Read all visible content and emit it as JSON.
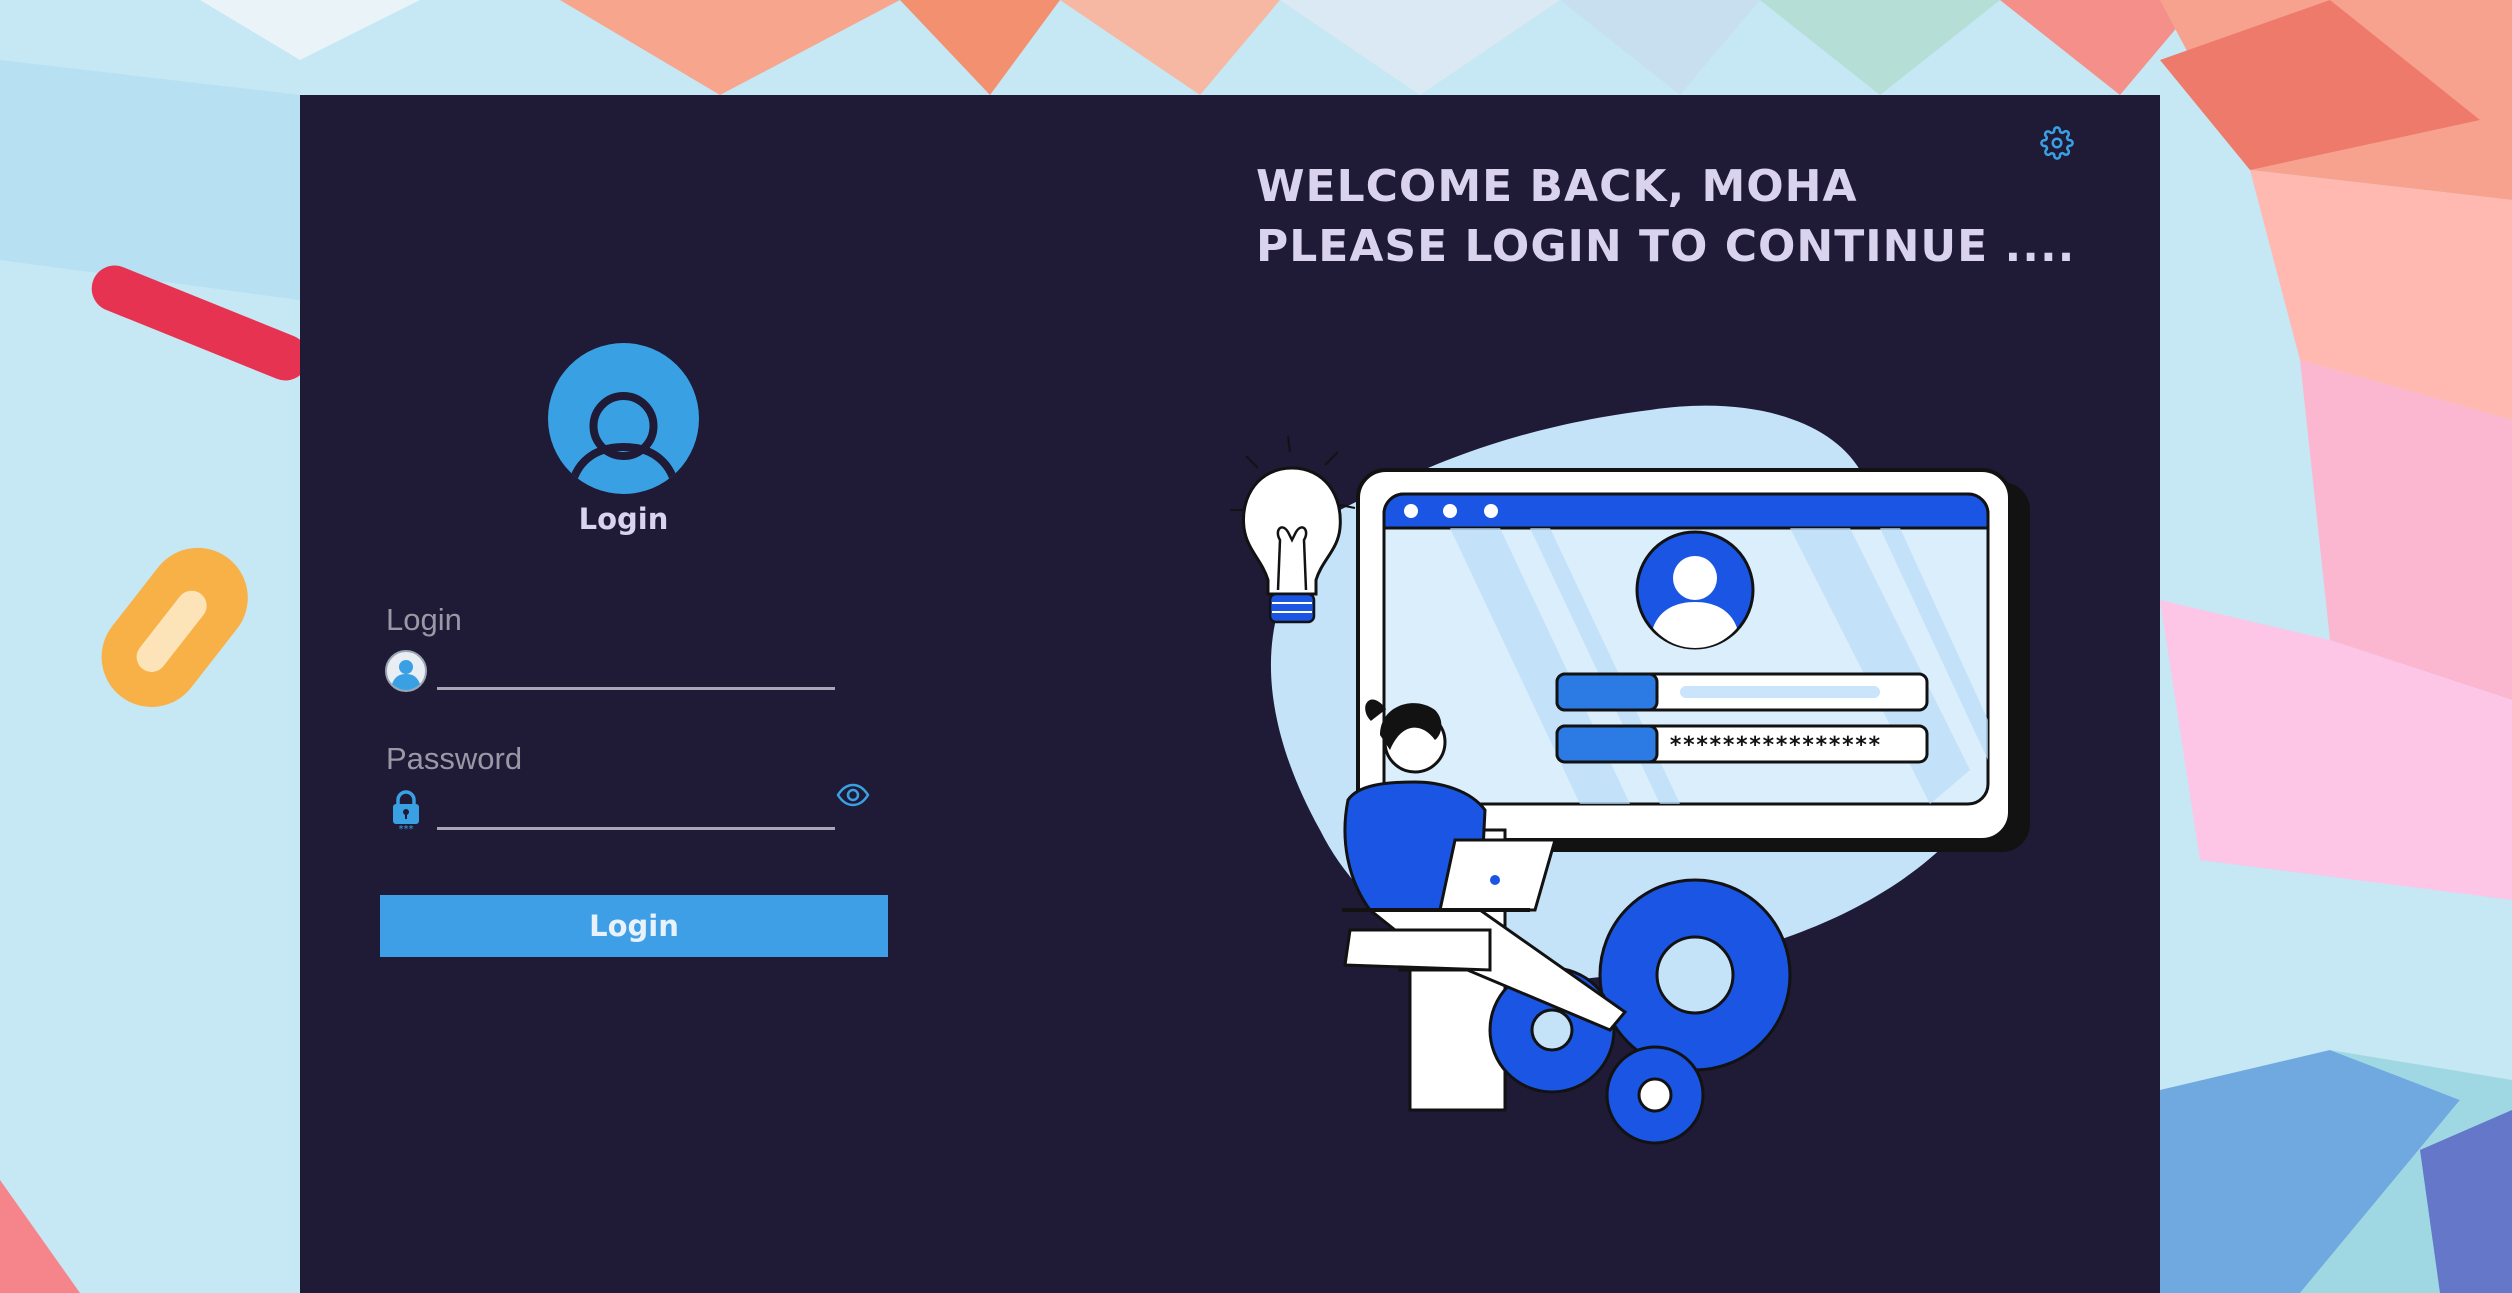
{
  "welcome": {
    "line1": "WELCOME BACK, MOHA",
    "line2": "PLEASE LOGIN TO CONTINUE ...."
  },
  "avatar": {
    "caption": "Login",
    "icon": "user-avatar-icon"
  },
  "form": {
    "login_label": "Login",
    "login_value": "",
    "password_label": "Password",
    "password_value": "",
    "submit_label": "Login"
  },
  "icons": {
    "settings": "gear-icon",
    "user_field": "user-icon",
    "password_field": "lock-icon",
    "show_password": "eye-icon"
  },
  "illustration": {
    "masked_password": "****************"
  },
  "colors": {
    "window_bg": "#1f1a36",
    "accent": "#3e9ee6",
    "title_text": "#d9d3ee",
    "label_text": "#9a98a6"
  }
}
